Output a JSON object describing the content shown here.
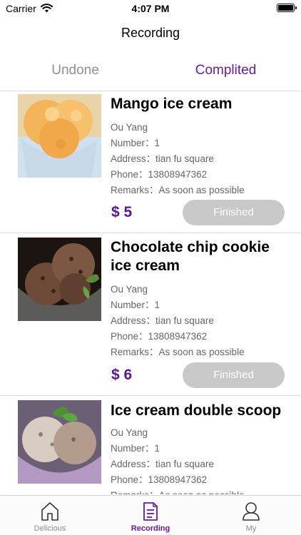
{
  "status_bar": {
    "carrier": "Carrier",
    "time": "4:07 PM"
  },
  "nav": {
    "title": "Recording"
  },
  "segments": {
    "undone": "Undone",
    "completed": "Complited"
  },
  "orders": [
    {
      "title": "Mango ice cream",
      "name": "Ou Yang",
      "number": "Number：1",
      "address": "Address：tian fu square",
      "phone": "Phone：13808947362",
      "remarks": "Remarks：As soon as possible",
      "price": "$ 5",
      "status": "Finished",
      "image": "mango-ice-cream-photo"
    },
    {
      "title": "Chocolate chip cookie ice cream",
      "name": "Ou Yang",
      "number": "Number：1",
      "address": "Address：tian fu square",
      "phone": "Phone：13808947362",
      "remarks": "Remarks：As soon as possible",
      "price": "$ 6",
      "status": "Finished",
      "image": "chocolate-ice-cream-photo"
    },
    {
      "title": "Ice cream double scoop",
      "name": "Ou Yang",
      "number": "Number：1",
      "address": "Address：tian fu square",
      "phone": "Phone：13808947362",
      "remarks": "Remarks：As soon as possible",
      "price": "",
      "status": "",
      "image": "double-scoop-ice-cream-photo"
    }
  ],
  "tabbar": {
    "items": [
      {
        "label": "Delicious",
        "icon": "home-icon"
      },
      {
        "label": "Recording",
        "icon": "document-icon"
      },
      {
        "label": "My",
        "icon": "person-icon"
      }
    ]
  },
  "colors": {
    "accent": "#6a1b9a",
    "price": "#5b159a",
    "button": "#c8c8c8"
  }
}
